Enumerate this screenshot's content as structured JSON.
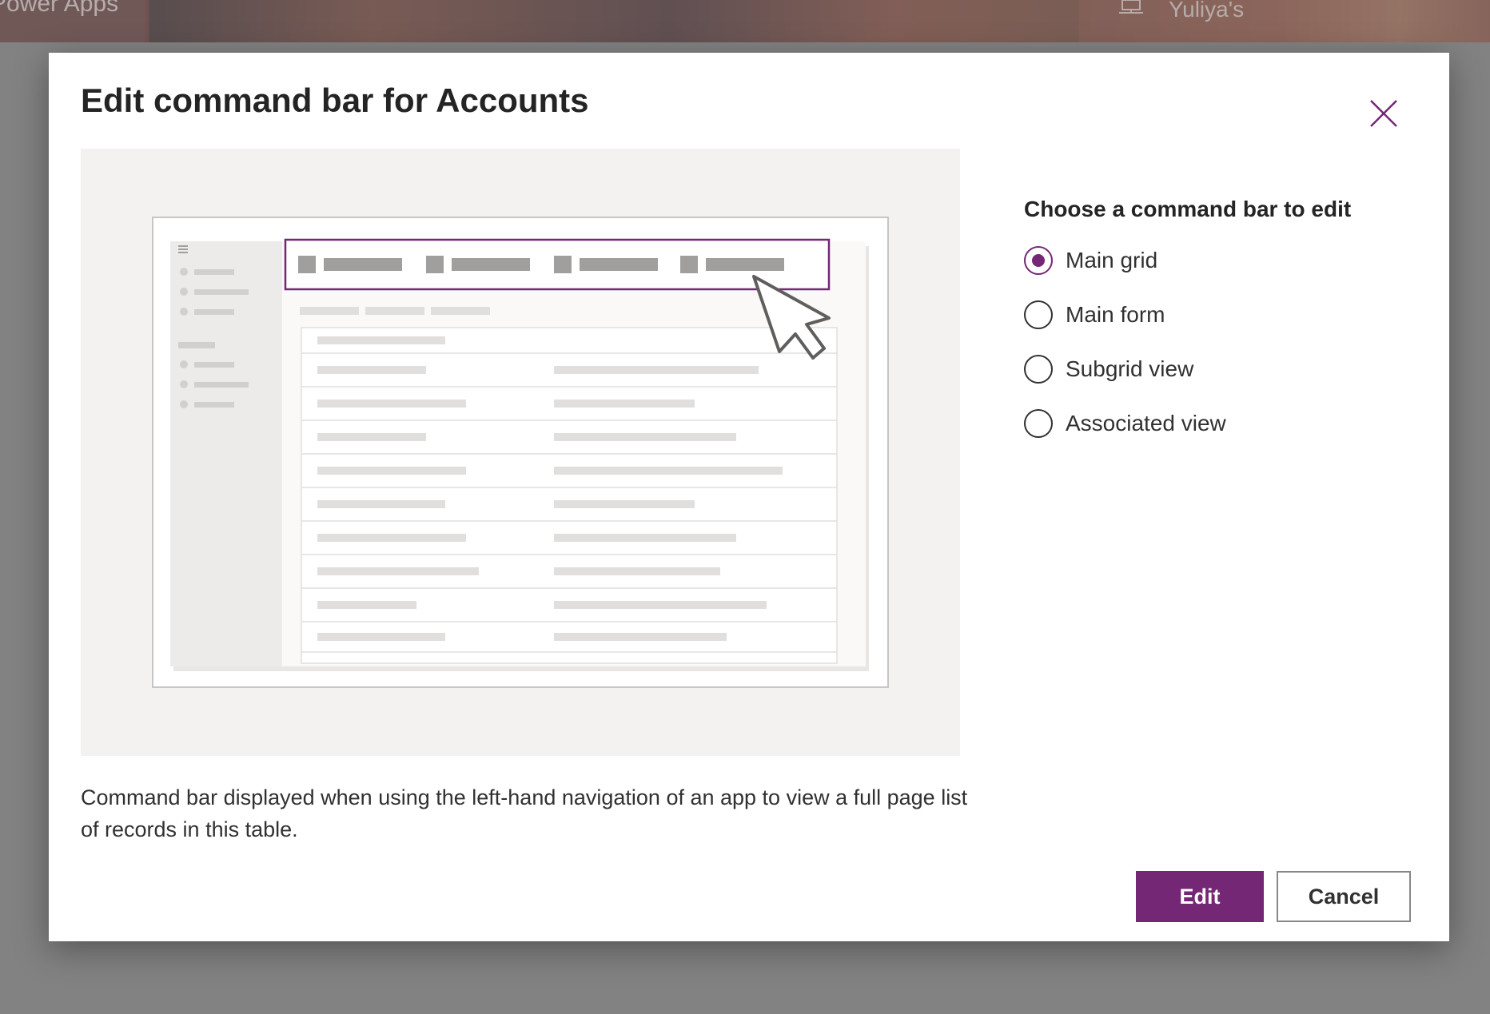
{
  "background": {
    "app_name": "Power Apps",
    "environment_name": "Yuliya's",
    "environment_icon": "environment-icon"
  },
  "dialog": {
    "title": "Edit command bar for Accounts",
    "close_icon": "close-icon",
    "preview_description": "Illustration of an app with its command bar highlighted",
    "description": "Command bar displayed when using the left-hand navigation of an app to view a full page list of records in this table.",
    "options": {
      "heading": "Choose a command bar to edit",
      "items": [
        {
          "label": "Main grid",
          "selected": true
        },
        {
          "label": "Main form",
          "selected": false
        },
        {
          "label": "Subgrid view",
          "selected": false
        },
        {
          "label": "Associated view",
          "selected": false
        }
      ]
    },
    "buttons": {
      "edit": "Edit",
      "cancel": "Cancel"
    }
  },
  "colors": {
    "accent": "#742774",
    "text": "#323130",
    "preview_bg": "#f3f2f1"
  }
}
